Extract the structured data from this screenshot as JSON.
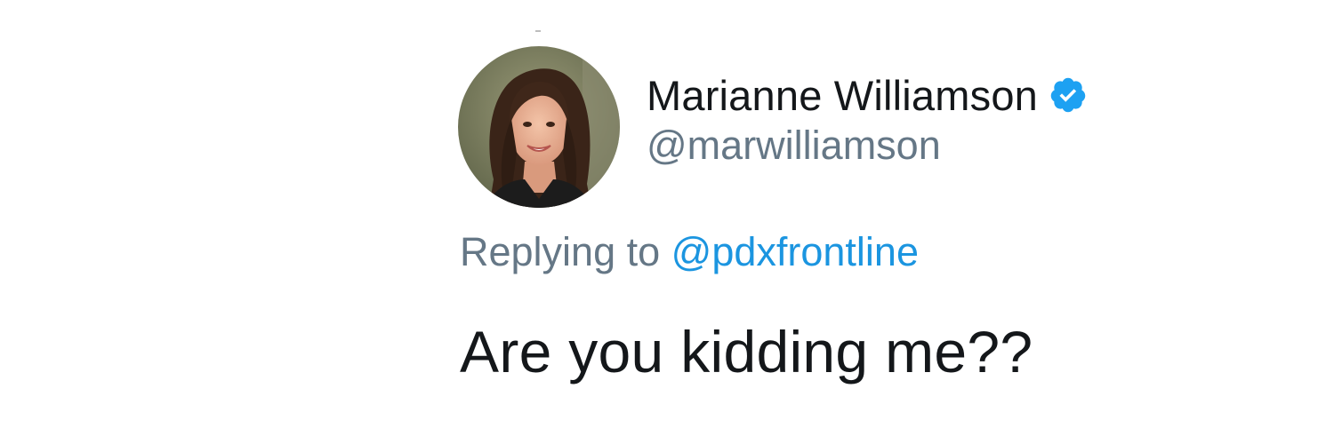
{
  "tweet": {
    "author": {
      "display_name": "Marianne Williamson",
      "handle": "@marwilliamson",
      "verified": true,
      "avatar_icon": "profile-photo"
    },
    "reply": {
      "prefix": "Replying to ",
      "target": "@pdxfrontline"
    },
    "text": "Are you kidding me??"
  },
  "colors": {
    "name": "#14171a",
    "secondary_text": "#657786",
    "link": "#1b95e0",
    "verified_badge": "#1da1f2",
    "background": "#ffffff"
  }
}
